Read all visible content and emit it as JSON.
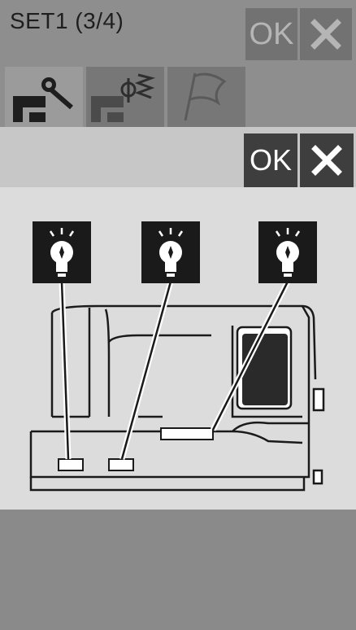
{
  "title": "SET1 (3/4)",
  "top_buttons": {
    "ok_label": "OK"
  },
  "dialog": {
    "ok_label": "OK"
  },
  "icons": {
    "close": "close-icon",
    "tabs": [
      "machine-settings-icon",
      "embroidery-settings-icon",
      "general-settings-icon"
    ],
    "lights": [
      "light-bulb-icon",
      "light-bulb-icon",
      "light-bulb-icon"
    ]
  },
  "colors": {
    "background": "#8a8a8a",
    "dialog_bg": "#dcdcdc",
    "dialog_button": "#3e3e3e",
    "top_button": "#727272"
  }
}
